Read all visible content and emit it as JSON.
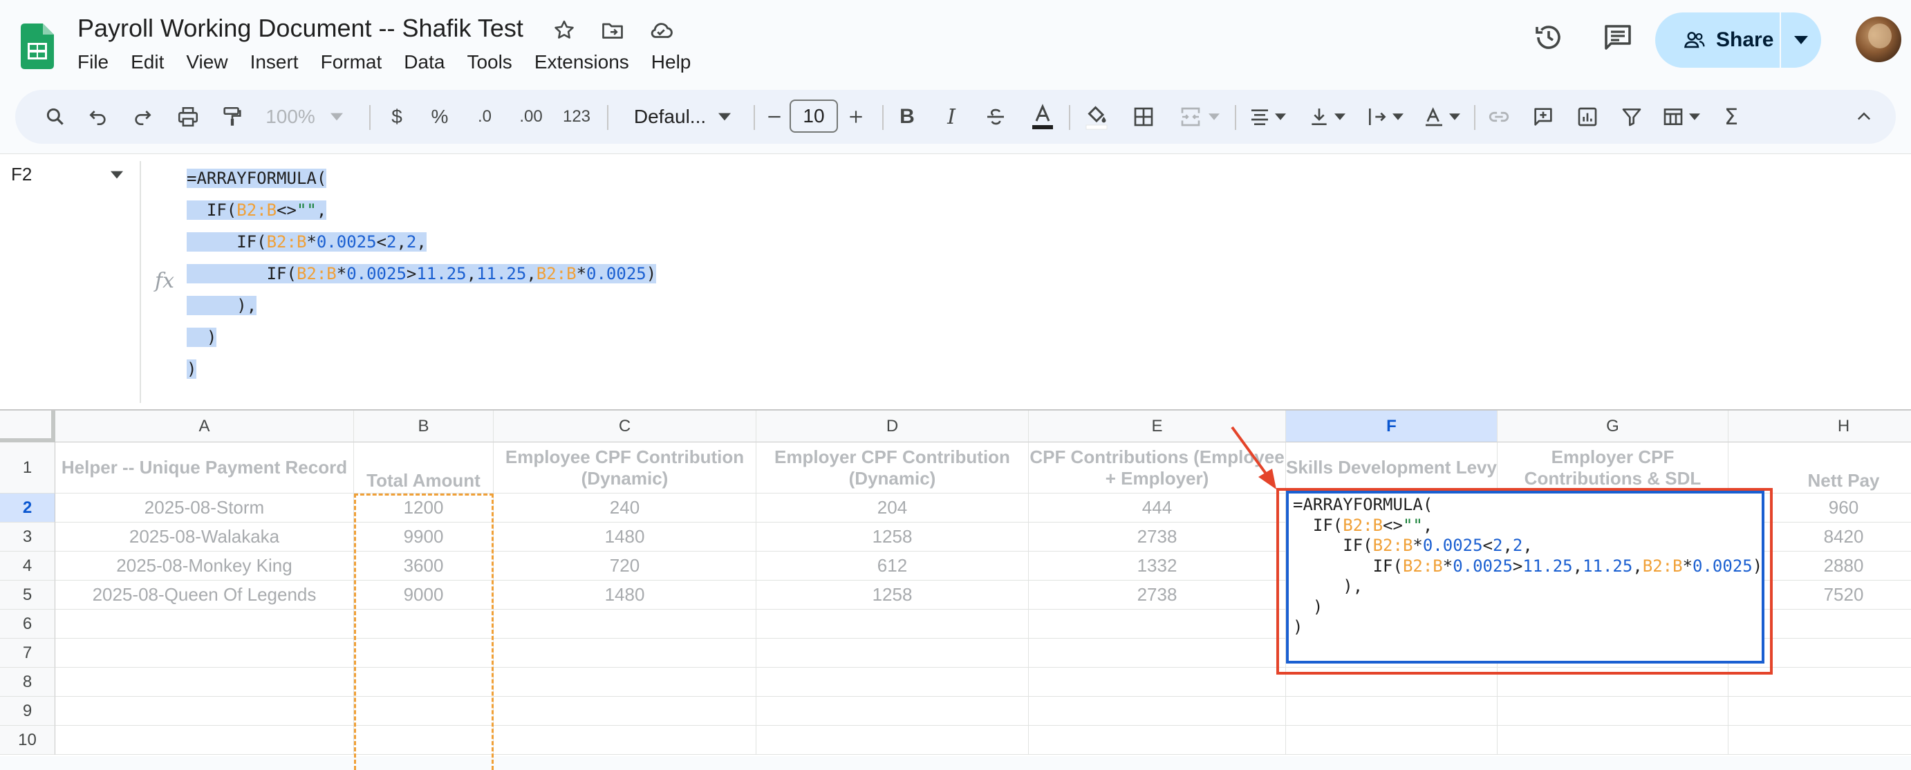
{
  "app": {
    "doc_title": "Payroll Working Document -- Shafik Test",
    "menu": [
      "File",
      "Edit",
      "View",
      "Insert",
      "Format",
      "Data",
      "Tools",
      "Extensions",
      "Help"
    ],
    "share_label": "Share"
  },
  "toolbar": {
    "zoom": "100%",
    "currency": "$",
    "percent": "%",
    "dec_decrease": ".0",
    "dec_increase": ".00",
    "number_format": "123",
    "font_family": "Defaul...",
    "font_size": "10"
  },
  "formula_bar": {
    "name_box": "F2",
    "fx_label": "fx"
  },
  "grid": {
    "columns": [
      "A",
      "B",
      "C",
      "D",
      "E",
      "F",
      "G",
      "H"
    ],
    "rows": [
      "1",
      "2",
      "3",
      "4",
      "5",
      "6",
      "7",
      "8",
      "9",
      "10"
    ],
    "active_cell": "F2",
    "header_row": [
      "Helper -- Unique Payment Record",
      "Total Amount",
      "Employee CPF Contribution (Dynamic)",
      "Employer CPF Contribution (Dynamic)",
      "CPF Contributions (Employee + Employer)",
      "Skills Development Levy",
      "Employer CPF Contributions & SDL",
      "Nett Pay"
    ],
    "data_rows": [
      [
        "2025-08-Storm",
        "1200",
        "240",
        "204",
        "444",
        "",
        "",
        "960"
      ],
      [
        "2025-08-Walakaka",
        "9900",
        "1480",
        "1258",
        "2738",
        "",
        "",
        "8420"
      ],
      [
        "2025-08-Monkey King",
        "3600",
        "720",
        "612",
        "1332",
        "",
        "",
        "2880"
      ],
      [
        "2025-08-Queen Of Legends",
        "9000",
        "1480",
        "1258",
        "2738",
        "",
        "",
        "7520"
      ]
    ]
  },
  "formula": {
    "lines": [
      [
        {
          "t": "=ARRAYFORMULA(",
          "c": "op"
        }
      ],
      [
        {
          "t": "  IF(",
          "c": "op"
        },
        {
          "t": "B2:B",
          "c": "ref"
        },
        {
          "t": "<>",
          "c": "op"
        },
        {
          "t": "\"\"",
          "c": "str"
        },
        {
          "t": ",",
          "c": "op"
        }
      ],
      [
        {
          "t": "     IF(",
          "c": "op"
        },
        {
          "t": "B2:B",
          "c": "ref"
        },
        {
          "t": "*",
          "c": "op"
        },
        {
          "t": "0.0025",
          "c": "num"
        },
        {
          "t": "<",
          "c": "op"
        },
        {
          "t": "2",
          "c": "num"
        },
        {
          "t": ",",
          "c": "op"
        },
        {
          "t": "2",
          "c": "num"
        },
        {
          "t": ",",
          "c": "op"
        }
      ],
      [
        {
          "t": "        IF(",
          "c": "op"
        },
        {
          "t": "B2:B",
          "c": "ref"
        },
        {
          "t": "*",
          "c": "op"
        },
        {
          "t": "0.0025",
          "c": "num"
        },
        {
          "t": ">",
          "c": "op"
        },
        {
          "t": "11.25",
          "c": "num"
        },
        {
          "t": ",",
          "c": "op"
        },
        {
          "t": "11.25",
          "c": "num"
        },
        {
          "t": ",",
          "c": "op"
        },
        {
          "t": "B2:B",
          "c": "ref"
        },
        {
          "t": "*",
          "c": "op"
        },
        {
          "t": "0.0025",
          "c": "num"
        },
        {
          "t": ")",
          "c": "op"
        }
      ],
      [
        {
          "t": "     ),",
          "c": "op"
        }
      ],
      [
        {
          "t": "  )",
          "c": "op"
        }
      ],
      [
        {
          "t": ")",
          "c": "op"
        }
      ]
    ]
  },
  "colors": {
    "accent": "#1a5fd1",
    "reference": "#f0a037",
    "number": "#1a5fd1",
    "string": "#188038",
    "annotation": "#e4442a",
    "share_bg": "#c2e7ff"
  }
}
